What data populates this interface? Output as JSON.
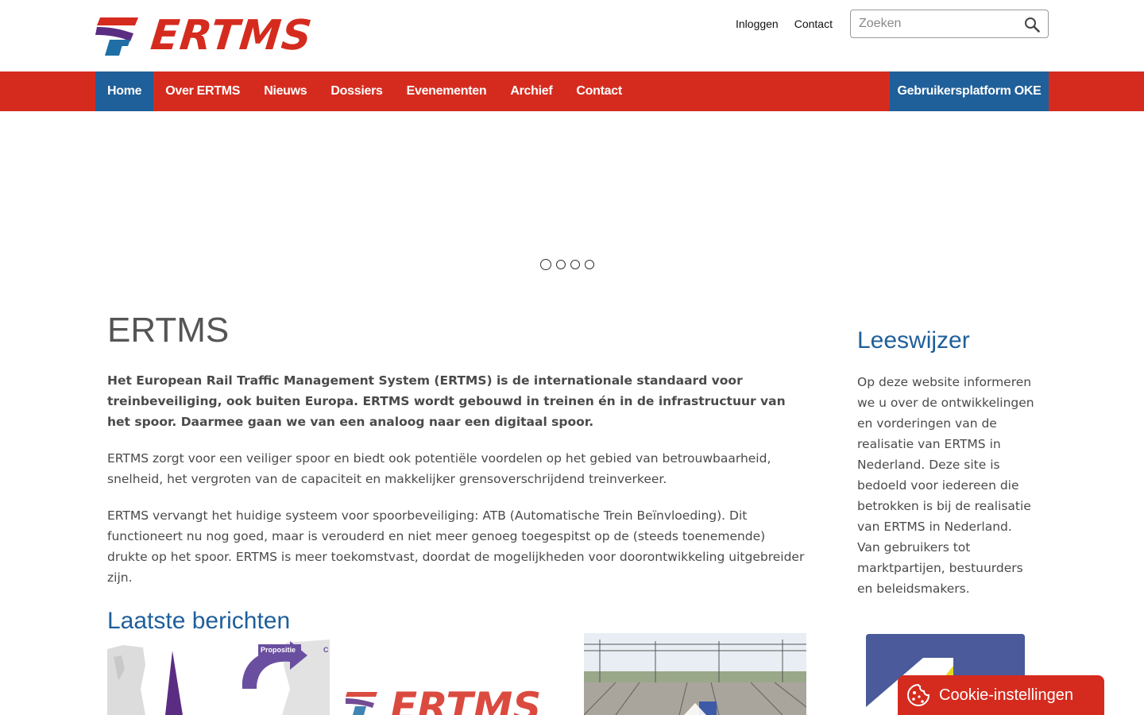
{
  "header": {
    "logo_text": "ERTMS",
    "links": [
      "Inloggen",
      "Contact"
    ],
    "search_placeholder": "Zoeken"
  },
  "nav": {
    "items": [
      "Home",
      "Over ERTMS",
      "Nieuws",
      "Dossiers",
      "Evenementen",
      "Archief",
      "Contact"
    ],
    "active": "Home",
    "cta": "Gebruikersplatform OKE"
  },
  "slider": {
    "slide_count": 4,
    "active_index": 0
  },
  "main": {
    "title": "ERTMS",
    "lead": "Het European Rail Traffic Management System (ERTMS) is de internationale standaard voor treinbeveiliging, ook buiten Europa. ERTMS wordt gebouwd in treinen én in de infrastructuur van het spoor. Daarmee gaan we van een analoog naar een digitaal spoor.",
    "paragraphs": [
      "ERTMS zorgt voor een veiliger spoor en biedt ook potentiële voordelen op het gebied van betrouwbaarheid, snelheid, het vergroten van de capaciteit en makkelijker grensoverschrijdend treinverkeer.",
      "ERTMS vervangt het huidige systeem voor spoorbeveiliging: ATB (Automatische Trein Beïnvloeding). Dit functioneert nu nog goed, maar is verouderd en niet meer genoeg toegespitst op de (steeds toenemende) drukte op het spoor. ERTMS is meer toekomstvast, doordat de mogelijkheden voor doorontwikkeling uitgebreider zijn."
    ],
    "section_title": "Laatste berichten",
    "cards": [
      {
        "image": "map-diagram",
        "label": "Propositie"
      },
      {
        "image": "ertms-logo",
        "label": "ERTMS"
      },
      {
        "image": "railway-photo"
      }
    ]
  },
  "sidebar": {
    "title": "Leeswijzer",
    "text": "Op deze website informeren we u over de ontwikkelingen en vorderingen van de realisatie van ERTMS in Nederland. Deze site is bedoeld voor iedereen die betrokken is bij de realisatie van ERTMS in Nederland. Van gebruikers tot marktpartijen, bestuurders en beleidsmakers."
  },
  "cookie": {
    "label": "Cookie-instellingen",
    "icon": "cookie-icon"
  },
  "colors": {
    "brand_red": "#d52b1e",
    "brand_blue": "#1f5f9a",
    "brand_purple": "#5b2d82"
  }
}
